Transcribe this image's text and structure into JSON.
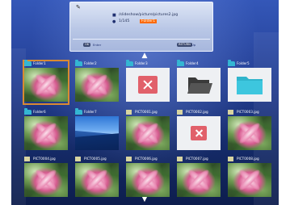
{
  "info_panel": {
    "path": "/slideshow/picture/pictures2.jpg",
    "count_current": "1/145",
    "selected_name": "Folder1",
    "hints": [
      {
        "key": "OK",
        "label": "Enter"
      },
      {
        "key": "RETURN",
        "label": "Up"
      }
    ]
  },
  "grid": {
    "rows": [
      [
        {
          "label": "Folder1",
          "kind": "folder",
          "thumb": "photo",
          "selected": true
        },
        {
          "label": "Folder2",
          "kind": "folder",
          "thumb": "photo"
        },
        {
          "label": "Folder3",
          "kind": "folder",
          "thumb": "error"
        },
        {
          "label": "Folder4",
          "kind": "folder",
          "thumb": "folder-dark-icon"
        },
        {
          "label": "Folder5",
          "kind": "folder",
          "thumb": "folder-teal-icon"
        }
      ],
      [
        {
          "label": "Folder6",
          "kind": "folder",
          "thumb": "photo"
        },
        {
          "label": "Folder7",
          "kind": "folder",
          "thumb": "sky"
        },
        {
          "label": "PICT0001.jpg",
          "kind": "file",
          "thumb": "photo"
        },
        {
          "label": "PICT0002.jpg",
          "kind": "file",
          "thumb": "error"
        },
        {
          "label": "PICT0003.jpg",
          "kind": "file",
          "thumb": "photo"
        }
      ],
      [
        {
          "label": "PICT0004.jpg",
          "kind": "file",
          "thumb": "photo"
        },
        {
          "label": "PICT0005.jpg",
          "kind": "file",
          "thumb": "photo"
        },
        {
          "label": "PICT0006.jpg",
          "kind": "file",
          "thumb": "photo"
        },
        {
          "label": "PICT0007.jpg",
          "kind": "file",
          "thumb": "photo"
        },
        {
          "label": "PICT0008.jpg",
          "kind": "file",
          "thumb": "photo"
        }
      ]
    ]
  },
  "colors": {
    "selection": "#d98a33",
    "folder_tab": "#34b6d3",
    "error_icon": "#e1606a",
    "highlight": "#ff6a00"
  }
}
